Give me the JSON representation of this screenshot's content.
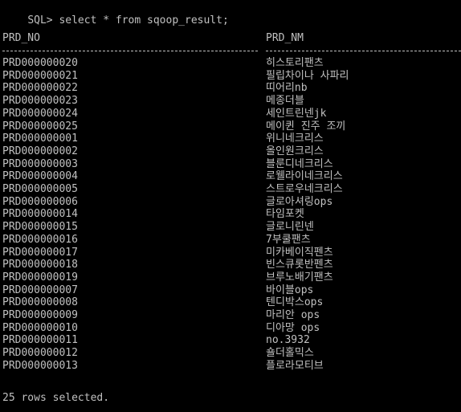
{
  "console": {
    "prompt": "SQL>",
    "command": "select * from sqoop_result;",
    "columns": [
      "PRD_NO",
      "PRD_NM"
    ],
    "rows": [
      [
        "PRD000000020",
        "히스토리팬츠"
      ],
      [
        "PRD000000021",
        "필립차이나 사파리"
      ],
      [
        "PRD000000022",
        "띠어리nb"
      ],
      [
        "PRD000000023",
        "메종더블"
      ],
      [
        "PRD000000024",
        "세인트린넨jk"
      ],
      [
        "PRD000000025",
        "메이퀸 진주 조끼"
      ],
      [
        "PRD000000001",
        "위니네크리스"
      ],
      [
        "PRD000000002",
        "올인원크리스"
      ],
      [
        "PRD000000003",
        "블룬디네크리스"
      ],
      [
        "PRD000000004",
        "로웰라이네크리스"
      ],
      [
        "PRD000000005",
        "스트로우네크리스"
      ],
      [
        "PRD000000006",
        "글로아셔링ops"
      ],
      [
        "PRD000000014",
        "타임포켓"
      ],
      [
        "PRD000000015",
        "글로니린넨"
      ],
      [
        "PRD000000016",
        "7부쿨팬츠"
      ],
      [
        "PRD000000017",
        "미카베이직펜츠"
      ],
      [
        "PRD000000018",
        "빈스큐롯반펜츠"
      ],
      [
        "PRD000000019",
        "브루노배기팬츠"
      ],
      [
        "PRD000000007",
        "바이블ops"
      ],
      [
        "PRD000000008",
        "텐디박스ops"
      ],
      [
        "PRD000000009",
        "마리안 ops"
      ],
      [
        "PRD000000010",
        "디아망 ops"
      ],
      [
        "PRD000000011",
        "no.3932"
      ],
      [
        "PRD000000012",
        "숄더홀믹스"
      ],
      [
        "PRD000000013",
        "플로라모티브"
      ]
    ],
    "footer": "25 rows selected."
  },
  "colors": {
    "background": "#000000",
    "text": "#c0c0c0"
  }
}
